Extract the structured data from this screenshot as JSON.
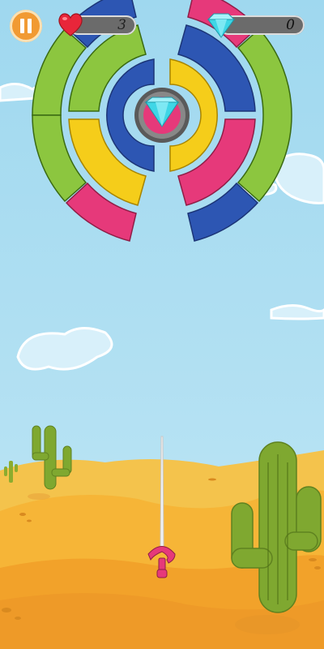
{
  "hud": {
    "lives": "3",
    "gems": "0",
    "pause_icon": "pause-icon",
    "lives_icon": "heart-icon",
    "gems_icon": "diamond-icon"
  },
  "colors": {
    "blue": "#2d56b3",
    "green": "#8cc63f",
    "yellow": "#f5cd1a",
    "pink": "#e6397a",
    "sky": "#a8dcf0",
    "sand": "#f5b43a",
    "gem": "#3fd6e6",
    "pause": "#f19a33"
  },
  "target": {
    "center_icon": "diamond-icon",
    "rings": [
      {
        "name": "outer",
        "segments": [
          "green",
          "blue",
          "pink",
          "green",
          "blue",
          "pink",
          "blue",
          "green"
        ]
      },
      {
        "name": "middle",
        "segments": [
          "green",
          "blue",
          "yellow",
          "blue",
          "pink",
          "yellow"
        ]
      },
      {
        "name": "inner",
        "segments": [
          "blue",
          "yellow"
        ]
      }
    ]
  },
  "player": {
    "weapon_icon": "sword-icon"
  }
}
